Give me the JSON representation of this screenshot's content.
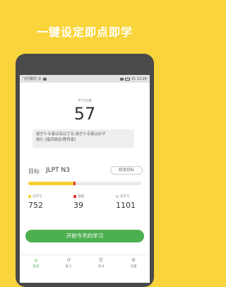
{
  "promo": {
    "headline": "一键设定即点即学"
  },
  "statusbar": {
    "carrier": "飞行模式 令",
    "status_right": "15 13:24"
  },
  "study": {
    "days_label": "学习天数",
    "days_value": "57",
    "quote_line1": "過ぎたる者は及ばざる,過ぎたる者は必ず",
    "quote_line2": "滅む [福沢諭吉/教育者]"
  },
  "goal": {
    "label": "目标",
    "value": "JLPT N3",
    "edit_label": "修改目标"
  },
  "progress": {
    "learned_fraction": 0.4,
    "forgotten_fraction": 0.018
  },
  "stats": [
    {
      "label": "已学习",
      "value": "752",
      "color": "#F5D033"
    },
    {
      "label": "错题",
      "value": "39",
      "color": "#E53935"
    },
    {
      "label": "未学习",
      "value": "1101",
      "color": "#D9D9D9"
    }
  ],
  "start_button": {
    "label": "开始今天的学习"
  },
  "tabs": [
    {
      "label": "首页",
      "icon": "home-icon"
    },
    {
      "label": "复习",
      "icon": "review-icon"
    },
    {
      "label": "考试",
      "icon": "exam-icon"
    },
    {
      "label": "设置",
      "icon": "settings-icon"
    }
  ],
  "colors": {
    "background": "#F9D43A",
    "accent": "#4CAF50",
    "learned": "#F5D033",
    "forgotten": "#E53935"
  }
}
